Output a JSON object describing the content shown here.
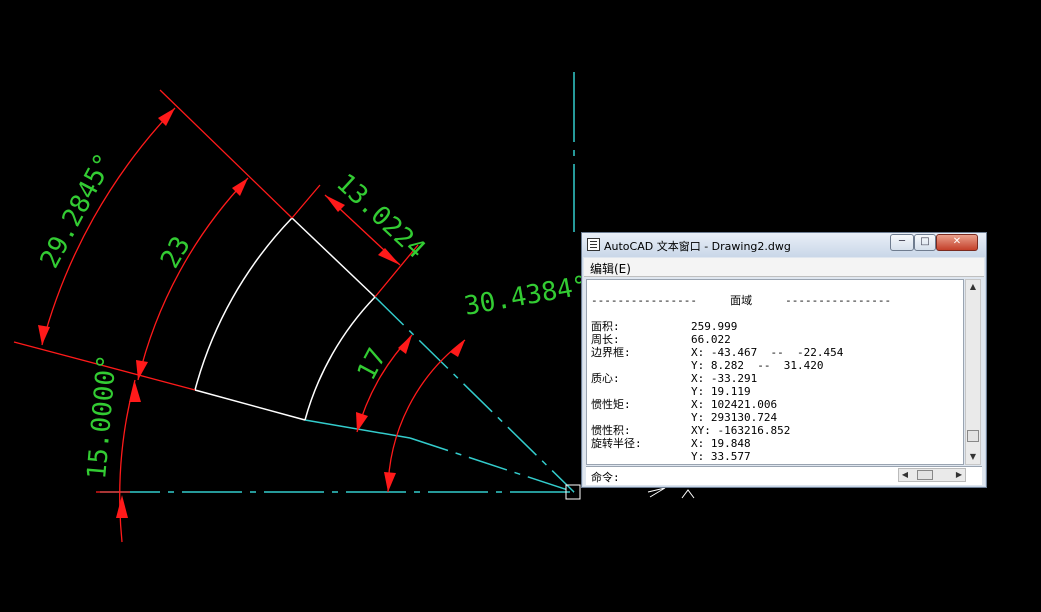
{
  "drawing": {
    "dims": {
      "angle_outer": "29.2845°",
      "radius_outer": "23",
      "chord": "13.0224",
      "angle_right": "30.4384°",
      "radius_inner": "17",
      "angle_bottom": "15.0000°"
    },
    "colors": {
      "dimension": "#ff1a1a",
      "dimension_text": "#33cc33",
      "geometry": "#ffffff",
      "center_line": "#33cccc"
    }
  },
  "text_window": {
    "title": "AutoCAD 文本窗口 - Drawing2.dwg",
    "menu_edit": "编辑(E)",
    "header": "----------------     面域     ----------------",
    "rows": [
      {
        "label": "面积:",
        "value": "259.999"
      },
      {
        "label": "周长:",
        "value": "66.022"
      },
      {
        "label": "边界框:",
        "value": "X: -43.467  --  -22.454"
      },
      {
        "label": "",
        "value": "Y: 8.282  --  31.420"
      },
      {
        "label": "质心:",
        "value": "X: -33.291"
      },
      {
        "label": "",
        "value": "Y: 19.119"
      },
      {
        "label": "惯性矩:",
        "value": "X: 102421.006"
      },
      {
        "label": "",
        "value": "Y: 293130.724"
      },
      {
        "label": "惯性积:",
        "value": "XY: -163216.852"
      },
      {
        "label": "旋转半径:",
        "value": "X: 19.848"
      },
      {
        "label": "",
        "value": "Y: 33.577"
      }
    ],
    "command_label": "命令:",
    "buttons": {
      "minimize": "─",
      "maximize": "□",
      "close": "✕"
    }
  }
}
